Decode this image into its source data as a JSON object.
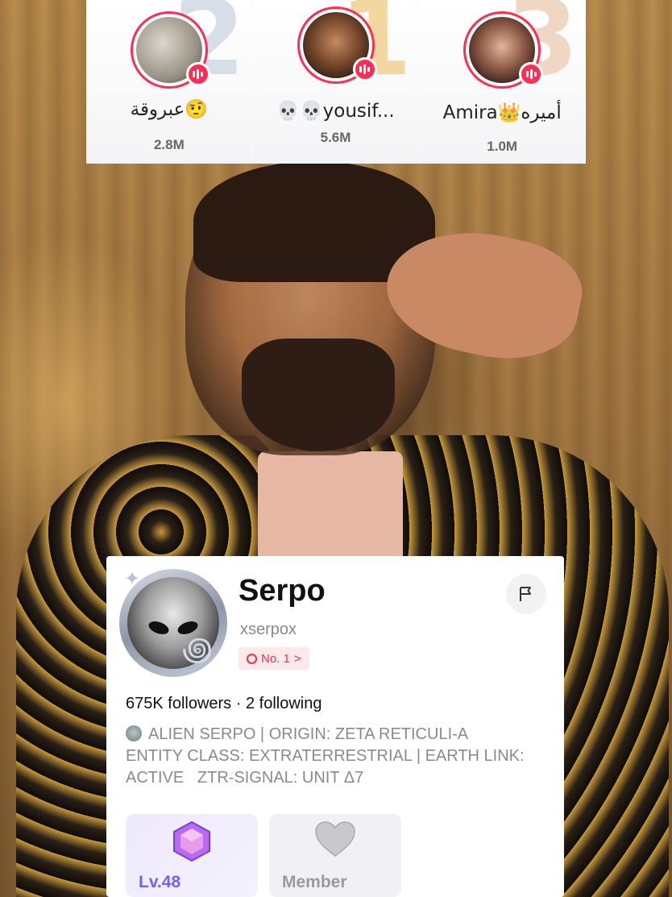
{
  "leaderboard": {
    "entries": [
      {
        "rank": "2",
        "name": "عبروقة🤨",
        "count": "2.8M"
      },
      {
        "rank": "1",
        "name": "💀💀yousif...",
        "count": "5.6M"
      },
      {
        "rank": "3",
        "name": "Amira👑أميره",
        "count": "1.0M"
      }
    ]
  },
  "profile": {
    "name": "Serpo",
    "handle": "xserpox",
    "rank_chip": "No. 1",
    "rank_chip_chevron": ">",
    "follow_stats": "675K followers · 2 following",
    "bio": "ALIEN SERPO | ORIGIN: ZETA RETICULI-A\nENTITY CLASS: EXTRATERRESTRIAL | EARTH LINK:\nACTIVE   ZTR-SIGNAL: UNIT Δ7",
    "badges": [
      {
        "label": "Lv.48",
        "icon": "gem-icon"
      },
      {
        "label": "Member",
        "icon": "heart-icon"
      }
    ]
  },
  "colors": {
    "live_red": "#fe2c55",
    "level_purple": "#7a5ef0",
    "chip_red": "#e8344e"
  }
}
